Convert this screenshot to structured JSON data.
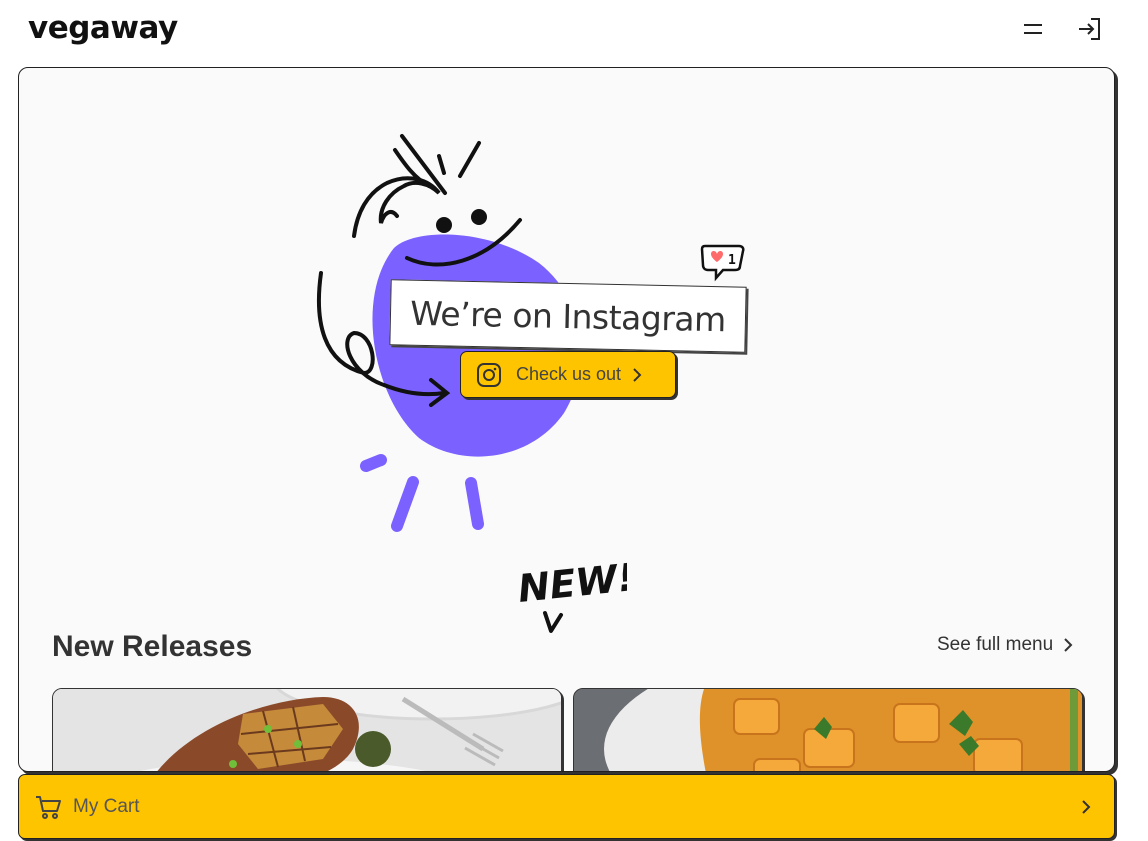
{
  "header": {
    "logo": "vegaway",
    "icons": {
      "menu": "menu-icon",
      "login": "login-icon"
    }
  },
  "hero": {
    "instagram_label": "We’re on Instagram",
    "check_button_label": "Check us out",
    "new_tag": "NEW!",
    "like_count": "1",
    "colors": {
      "blob": "#7b61ff",
      "accent": "#ffc400",
      "heart": "#ff6b6b"
    }
  },
  "releases": {
    "title": "New Releases",
    "see_full_menu": "See full menu",
    "cards": [
      {
        "alt": "grilled-eggplant-dish"
      },
      {
        "alt": "curry-tofu-dish"
      }
    ]
  },
  "cart": {
    "label": "My Cart",
    "icon": "cart-icon"
  }
}
